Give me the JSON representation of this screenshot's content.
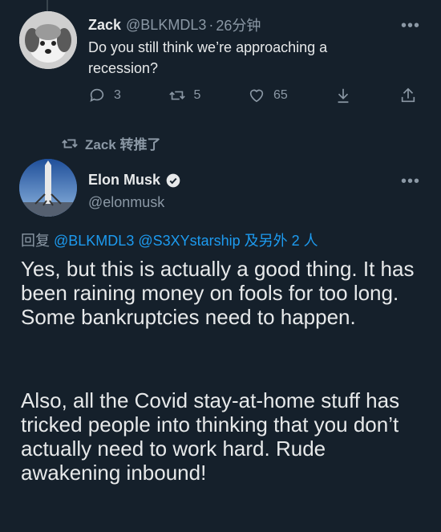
{
  "quoted_tweet": {
    "author_name": "Zack",
    "handle": "@BLKMDL3",
    "separator": "·",
    "time": "26分钟",
    "text": "Do you still think we’re approaching a recession?",
    "more_icon": "more-horizontal-icon",
    "actions": {
      "reply_count": "3",
      "retweet_count": "5",
      "like_count": "65"
    }
  },
  "retweet_bar": {
    "label": "Zack 转推了",
    "icon": "retweet-icon"
  },
  "main_tweet": {
    "author_name": "Elon Musk",
    "handle": "@elonmusk",
    "verified_icon": "verified-badge-icon",
    "more_icon": "more-horizontal-icon",
    "reply_prefix": "回复",
    "reply_mentions": "@BLKMDL3 @S3XYstarship",
    "reply_suffix": "及另外 2 人",
    "paragraph_1": "Yes, but this is actually a good thing. It has been raining money on fools for too long. Some bankruptcies need to happen.",
    "paragraph_2": "Also, all the Covid stay-at-home stuff has tricked people into thinking that you don’t actually need to work hard. Rude awakening inbound!"
  },
  "colors": {
    "background": "#15202b",
    "text": "#e7e9ea",
    "muted": "#8b98a5",
    "accent": "#1d9bf0"
  }
}
